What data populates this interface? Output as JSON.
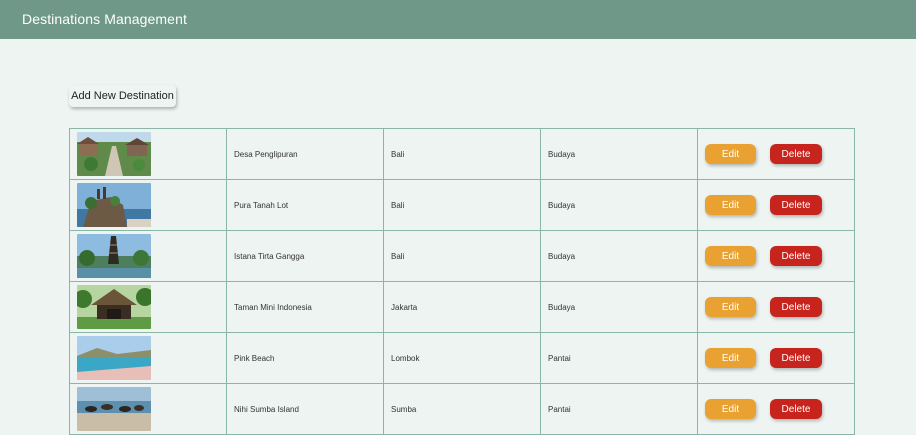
{
  "header": {
    "title": "Destinations Management"
  },
  "toolbar": {
    "add_label": "Add New Destination"
  },
  "destinations": [
    {
      "name": "Desa Penglipuran",
      "location": "Bali",
      "category": "Budaya",
      "edit_label": "Edit",
      "delete_label": "Delete",
      "image": "village-road-photo"
    },
    {
      "name": "Pura Tanah Lot",
      "location": "Bali",
      "category": "Budaya",
      "edit_label": "Edit",
      "delete_label": "Delete",
      "image": "sea-temple-photo"
    },
    {
      "name": "Istana Tirta Gangga",
      "location": "Bali",
      "category": "Budaya",
      "edit_label": "Edit",
      "delete_label": "Delete",
      "image": "water-palace-photo"
    },
    {
      "name": "Taman Mini Indonesia",
      "location": "Jakarta",
      "category": "Budaya",
      "edit_label": "Edit",
      "delete_label": "Delete",
      "image": "traditional-house-photo"
    },
    {
      "name": "Pink Beach",
      "location": "Lombok",
      "category": "Pantai",
      "edit_label": "Edit",
      "delete_label": "Delete",
      "image": "beach-photo"
    },
    {
      "name": "Nihi Sumba Island",
      "location": "Sumba",
      "category": "Pantai",
      "edit_label": "Edit",
      "delete_label": "Delete",
      "image": "horses-beach-photo"
    }
  ],
  "colors": {
    "header_bg": "#6f9888",
    "page_bg": "#eef4f1",
    "edit_button": "#e9a131",
    "delete_button": "#c6241d",
    "table_border": "#8bb5a6"
  }
}
